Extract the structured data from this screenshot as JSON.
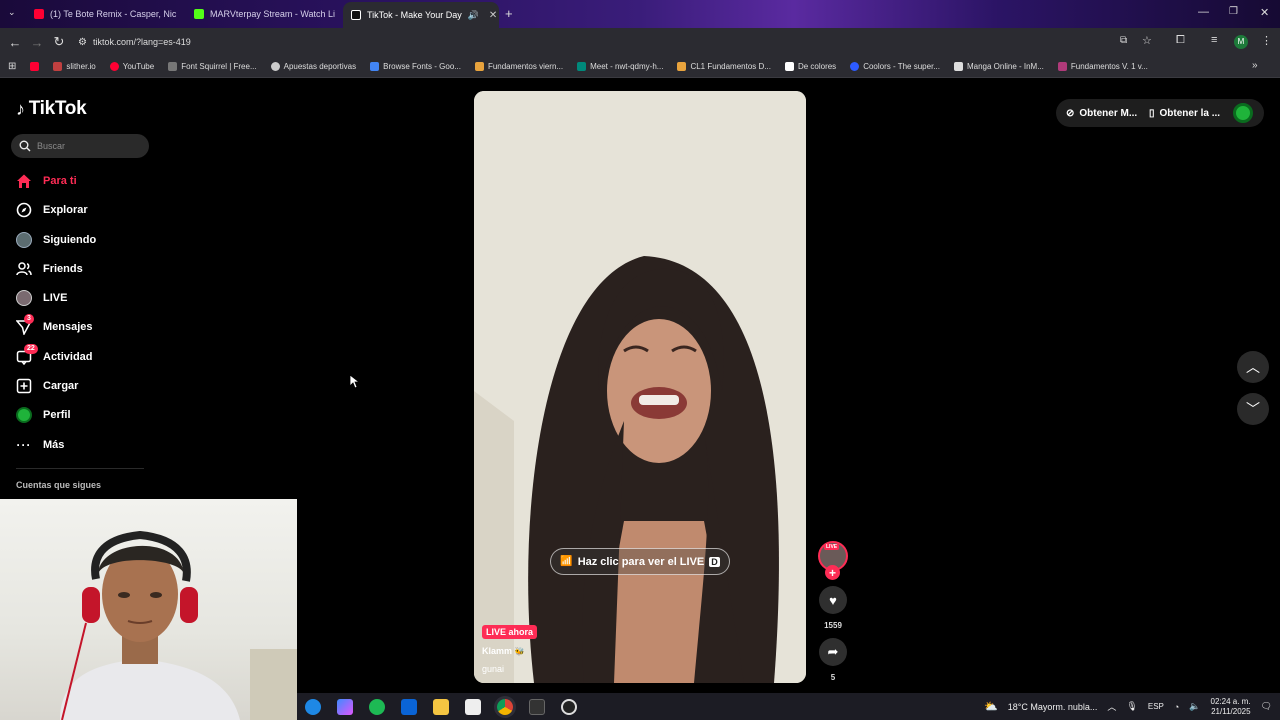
{
  "browser": {
    "tabs": [
      {
        "title": "(1) Te Bote Remix - Casper, Nic",
        "favicon_color": "#ff0033",
        "icon": "youtube-icon"
      },
      {
        "title": "MARVterpay Stream - Watch Li",
        "favicon_color": "#53fc18",
        "icon": "kick-icon"
      },
      {
        "title": "TikTok - Make Your Day",
        "favicon_color": "#ffffff",
        "icon": "tiktok-icon",
        "active": true
      }
    ],
    "url": "tiktok.com/?lang=es-419",
    "bookmarks": [
      {
        "label": "",
        "color": "#ff0033"
      },
      {
        "label": "slither.io",
        "color": "#c04040"
      },
      {
        "label": "YouTube",
        "color": "#ff0033"
      },
      {
        "label": "Font Squirrel | Free...",
        "color": "#777777"
      },
      {
        "label": "Apuestas deportivas",
        "color": "#cccccc"
      },
      {
        "label": "Browse Fonts - Goo...",
        "color": "#4285f4"
      },
      {
        "label": "Fundamentos viern...",
        "color": "#e8a33d"
      },
      {
        "label": "Meet - nwt-qdmy-h...",
        "color": "#00897b"
      },
      {
        "label": "CL1 Fundamentos D...",
        "color": "#e8a33d"
      },
      {
        "label": "De colores",
        "color": "#ffffff"
      },
      {
        "label": "Coolors - The super...",
        "color": "#2d5bff"
      },
      {
        "label": "Manga Online - InM...",
        "color": "#dddddd"
      },
      {
        "label": "Fundamentos V. 1 v...",
        "color": "#b03a7a"
      }
    ]
  },
  "tiktok": {
    "logo": "TikTok",
    "search_placeholder": "Buscar",
    "nav": [
      {
        "label": "Para ti",
        "icon": "home-icon",
        "active": true
      },
      {
        "label": "Explorar",
        "icon": "compass-icon"
      },
      {
        "label": "Siguiendo",
        "icon": "following-avatar-icon"
      },
      {
        "label": "Friends",
        "icon": "friends-icon"
      },
      {
        "label": "LIVE",
        "icon": "live-avatar-icon"
      },
      {
        "label": "Mensajes",
        "icon": "paper-plane-icon",
        "badge": "3"
      },
      {
        "label": "Actividad",
        "icon": "activity-icon",
        "badge": "22"
      },
      {
        "label": "Cargar",
        "icon": "plus-square-icon"
      },
      {
        "label": "Perfil",
        "icon": "profile-icon"
      },
      {
        "label": "Más",
        "icon": "more-icon"
      }
    ],
    "following_title": "Cuentas que sigues",
    "header": {
      "get_coins": "Obtener M...",
      "get_app": "Obtener la ..."
    },
    "video": {
      "live_button": "Haz clic para ver el LIVE",
      "live_tag": "LIVE ahora",
      "username": "Klamm",
      "caption": "gunai"
    },
    "actions": {
      "avatar_label": "LIVE",
      "likes": "1559",
      "shares": "5"
    }
  },
  "taskbar": {
    "weather": "18°C  Mayorm. nubla...",
    "lang": "ESP",
    "time": "02:24 a. m.",
    "date": "21/11/2025"
  }
}
